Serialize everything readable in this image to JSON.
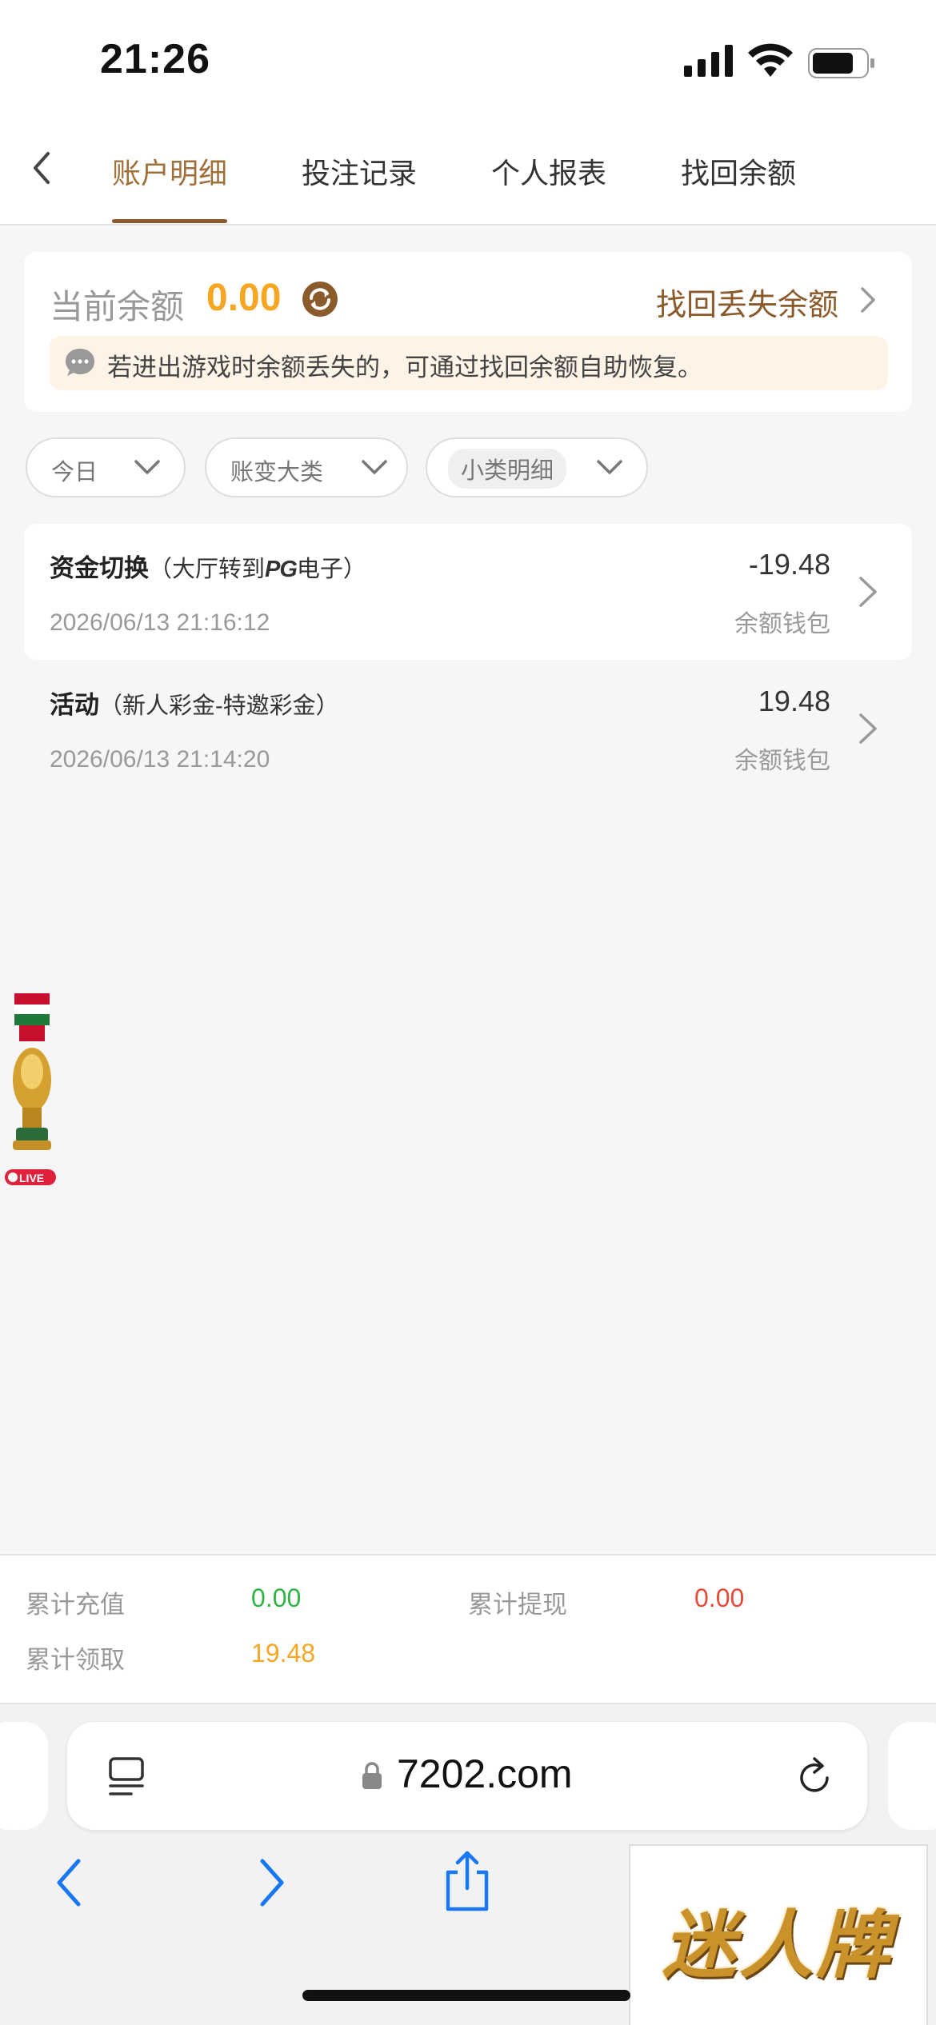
{
  "status_bar": {
    "time": "21:26"
  },
  "tabs": [
    {
      "label": "账户明细",
      "active": true
    },
    {
      "label": "投注记录",
      "active": false
    },
    {
      "label": "个人报表",
      "active": false
    },
    {
      "label": "找回余额",
      "active": false
    }
  ],
  "balance": {
    "label": "当前余额",
    "value": "0.00",
    "recover_link": "找回丢失余额",
    "notice": "若进出游戏时余额丢失的，可通过找回余额自助恢复。"
  },
  "filters": [
    {
      "label": "今日"
    },
    {
      "label": "账变大类"
    },
    {
      "label": "小类明细"
    }
  ],
  "records": [
    {
      "title": "资金切换",
      "sub_prefix": "（大厅转到",
      "sub_brand": "PG",
      "sub_suffix": "电子）",
      "date": "2026/06/13 21:16:12",
      "amount": "-19.48",
      "wallet": "余额钱包"
    },
    {
      "title": "活动",
      "sub": "（新人彩金-特邀彩金）",
      "date": "2026/06/13 21:14:20",
      "amount": "19.48",
      "wallet": "余额钱包"
    }
  ],
  "floating_badge": {
    "live": "LIVE"
  },
  "summary": {
    "deposit_label": "累计充值",
    "deposit_value": "0.00",
    "withdraw_label": "累计提现",
    "withdraw_value": "0.00",
    "claim_label": "累计领取",
    "claim_value": "19.48"
  },
  "browser": {
    "url": "7202.com"
  },
  "promo": {
    "brand": "迷人牌"
  },
  "colors": {
    "accent": "#8b5a2b",
    "balance": "#f5a623",
    "green": "#2fb344",
    "red": "#e64a3b"
  }
}
